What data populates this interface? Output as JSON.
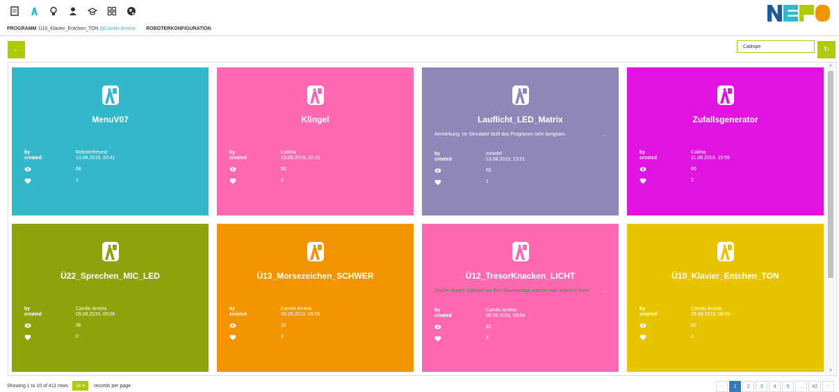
{
  "header": {
    "icons": [
      "list-icon",
      "robot-icon",
      "bulb-icon",
      "user-icon",
      "graduation-cap-icon",
      "grid-icon",
      "globe-icon"
    ],
    "program_label": "PROGRAMM",
    "program_name": "Ü10_Klavier_Entchen_TON",
    "user_name": "Camilo Arrieta",
    "robot_config_label": "ROBOTERKONFIGURATION"
  },
  "toolbar": {
    "back_glyph": "←",
    "search_value": "Calliope",
    "refresh_glyph": "↻"
  },
  "labels": {
    "by": "by",
    "created": "created"
  },
  "cards": [
    {
      "title": "MenuV07",
      "remark": "",
      "author": "Roboterfreund",
      "created": "13.08.2019, 20:41",
      "views": "68",
      "likes": "1",
      "color": "#33b8ca",
      "remark_color": "#ffffff"
    },
    {
      "title": "Klingel",
      "remark": "",
      "author": "Callina",
      "created": "13.08.2019, 20:25",
      "views": "90",
      "likes": "2",
      "color": "#ff69b4",
      "remark_color": "#ffffff"
    },
    {
      "title": "Lauflicht_LED_Matrix",
      "remark": "Anmerkung: Im Simulator läuft das Programm sehr lamgsam.",
      "author": "mriedel",
      "created": "13.08.2019, 13:51",
      "views": "65",
      "likes": "1",
      "color": "#8e88b9",
      "remark_color": "#ffffff"
    },
    {
      "title": "Zufallsgenerator",
      "remark": "",
      "author": "Callina",
      "created": "11.08.2019, 19:55",
      "views": "60",
      "likes": "2",
      "color": "#e014e0",
      "remark_color": "#ffffff"
    },
    {
      "title": "Ü22_Sprechen_MIC_LED",
      "remark": "",
      "author": "Camilo Arrieta",
      "created": "09.08.2019, 09:06",
      "views": "38",
      "likes": "0",
      "color": "#8fa20e",
      "remark_color": "#ffffff"
    },
    {
      "title": "Ü13_Morsezeichen_SCHWER",
      "remark": "",
      "author": "Camilo Arrieta",
      "created": "09.08.2019, 09:05",
      "views": "32",
      "likes": "0",
      "color": "#f29400",
      "remark_color": "#ffffff"
    },
    {
      "title": "Ü12_TresorKnacken_LICHT",
      "remark": "Mache deinen Calliope zur Box-Alarmanlage welche man knacken kann.",
      "author": "Camilo Arrieta",
      "created": "09.08.2019, 09:04",
      "views": "82",
      "likes": "2",
      "color": "#ff69b4",
      "remark_color": "#1f9e3a"
    },
    {
      "title": "Ü10_Klavier_Entchen_TON",
      "remark": "",
      "author": "Camilo Arrieta",
      "created": "09.08.2019, 08:49",
      "views": "60",
      "likes": "1",
      "color": "#e8c400",
      "remark_color": "#ffffff"
    }
  ],
  "footer": {
    "showing": "Showing 1 to 10 of 411 rows",
    "page_size": "10",
    "records_per_page": "records per page"
  },
  "pagination": {
    "prev": "‹",
    "pages": [
      "1",
      "2",
      "3",
      "4",
      "5",
      "...",
      "42"
    ],
    "next": "›",
    "active": "1"
  },
  "colors": {
    "accent": "#afca0b",
    "link": "#33b8ca",
    "pager_active": "#337ab7"
  }
}
